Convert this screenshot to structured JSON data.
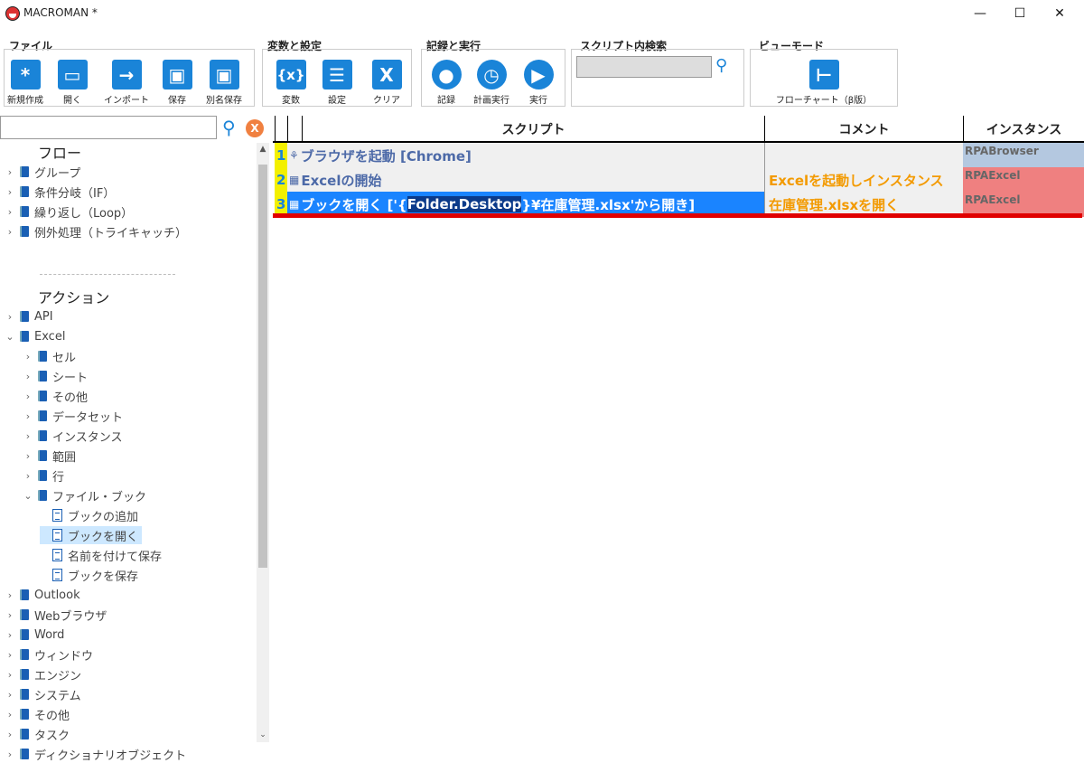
{
  "window": {
    "title": "MACROMAN *",
    "controls": {
      "minimize": "—",
      "maximize": "☐",
      "close": "✕"
    }
  },
  "ribbon": {
    "file": {
      "title": "ファイル",
      "buttons": [
        {
          "label": "新規作成",
          "icon": "new-icon",
          "glyph": "*"
        },
        {
          "label": "開く",
          "icon": "folder-icon",
          "glyph": "▭"
        },
        {
          "label": "インポート",
          "icon": "import-icon",
          "glyph": "→"
        },
        {
          "label": "保存",
          "icon": "save-icon",
          "glyph": "▣"
        },
        {
          "label": "別名保存",
          "icon": "save-as-icon",
          "glyph": "▣"
        }
      ]
    },
    "vars": {
      "title": "変数と設定",
      "buttons": [
        {
          "label": "変数",
          "icon": "variables-icon",
          "glyph": "{x}"
        },
        {
          "label": "設定",
          "icon": "settings-icon",
          "glyph": "☰"
        },
        {
          "label": "クリア",
          "icon": "clear-icon",
          "glyph": "X"
        }
      ]
    },
    "record": {
      "title": "記録と実行",
      "buttons": [
        {
          "label": "記録",
          "icon": "record-icon",
          "glyph": "●"
        },
        {
          "label": "計画実行",
          "icon": "schedule-icon",
          "glyph": "◷"
        },
        {
          "label": "実行",
          "icon": "run-icon",
          "glyph": "▶"
        }
      ]
    },
    "search": {
      "title": "スクリプト内検索",
      "value": ""
    },
    "view": {
      "title": "ビューモード",
      "buttons": [
        {
          "label": "フローチャート（β版）",
          "icon": "flowchart-icon",
          "glyph": "⊢"
        }
      ]
    }
  },
  "tree": {
    "search_value": "",
    "flow_heading": "フロー",
    "flow_items": [
      "グループ",
      "条件分岐（IF）",
      "繰り返し（Loop）",
      "例外処理（トライキャッチ）"
    ],
    "action_heading": "アクション",
    "action_items": [
      {
        "label": "API",
        "level": 0,
        "expanded": false,
        "kind": "folder"
      },
      {
        "label": "Excel",
        "level": 0,
        "expanded": true,
        "kind": "folder"
      },
      {
        "label": "セル",
        "level": 1,
        "expanded": false,
        "kind": "folder"
      },
      {
        "label": "シート",
        "level": 1,
        "expanded": false,
        "kind": "folder"
      },
      {
        "label": "その他",
        "level": 1,
        "expanded": false,
        "kind": "folder"
      },
      {
        "label": "データセット",
        "level": 1,
        "expanded": false,
        "kind": "folder"
      },
      {
        "label": "インスタンス",
        "level": 1,
        "expanded": false,
        "kind": "folder"
      },
      {
        "label": "範囲",
        "level": 1,
        "expanded": false,
        "kind": "folder"
      },
      {
        "label": "行",
        "level": 1,
        "expanded": false,
        "kind": "folder"
      },
      {
        "label": "ファイル・ブック",
        "level": 1,
        "expanded": true,
        "kind": "folder"
      },
      {
        "label": "ブックの追加",
        "level": 2,
        "kind": "doc"
      },
      {
        "label": "ブックを開く",
        "level": 2,
        "kind": "doc",
        "selected": true
      },
      {
        "label": "名前を付けて保存",
        "level": 2,
        "kind": "doc"
      },
      {
        "label": "ブックを保存",
        "level": 2,
        "kind": "doc"
      },
      {
        "label": "Outlook",
        "level": 0,
        "expanded": false,
        "kind": "folder"
      },
      {
        "label": "Webブラウザ",
        "level": 0,
        "expanded": false,
        "kind": "folder"
      },
      {
        "label": "Word",
        "level": 0,
        "expanded": false,
        "kind": "folder"
      },
      {
        "label": "ウィンドウ",
        "level": 0,
        "expanded": false,
        "kind": "folder"
      },
      {
        "label": "エンジン",
        "level": 0,
        "expanded": false,
        "kind": "folder"
      },
      {
        "label": "システム",
        "level": 0,
        "expanded": false,
        "kind": "folder"
      },
      {
        "label": "その他",
        "level": 0,
        "expanded": false,
        "kind": "folder"
      },
      {
        "label": "タスク",
        "level": 0,
        "expanded": false,
        "kind": "folder"
      },
      {
        "label": "ディクショナリオブジェクト",
        "level": 0,
        "expanded": false,
        "kind": "folder"
      }
    ]
  },
  "grid": {
    "headers": {
      "script": "スクリプト",
      "comment": "コメント",
      "instance": "インスタンス"
    },
    "rows": [
      {
        "num": "1",
        "icon": "browser-icon",
        "glyph": "⚘",
        "script": "ブラウザを起動 [Chrome]",
        "comment": "",
        "instance": "RPABrowser",
        "instance_color": "#b4c8e0"
      },
      {
        "num": "2",
        "icon": "excel-icon",
        "glyph": "▦",
        "script": "Excelの開始",
        "comment": "Excelを起動しインスタンス",
        "instance": "RPAExcel",
        "instance_color": "#ef8080"
      },
      {
        "num": "3",
        "icon": "excel-icon",
        "glyph": "▦",
        "script_pre": "ブックを開く ['{",
        "script_hl": "Folder.Desktop",
        "script_post": "}¥在庫管理.xlsx'から開き]",
        "comment": "在庫管理.xlsxを開く",
        "instance": "RPAExcel",
        "instance_color": "#ef8080",
        "selected": true
      }
    ]
  }
}
